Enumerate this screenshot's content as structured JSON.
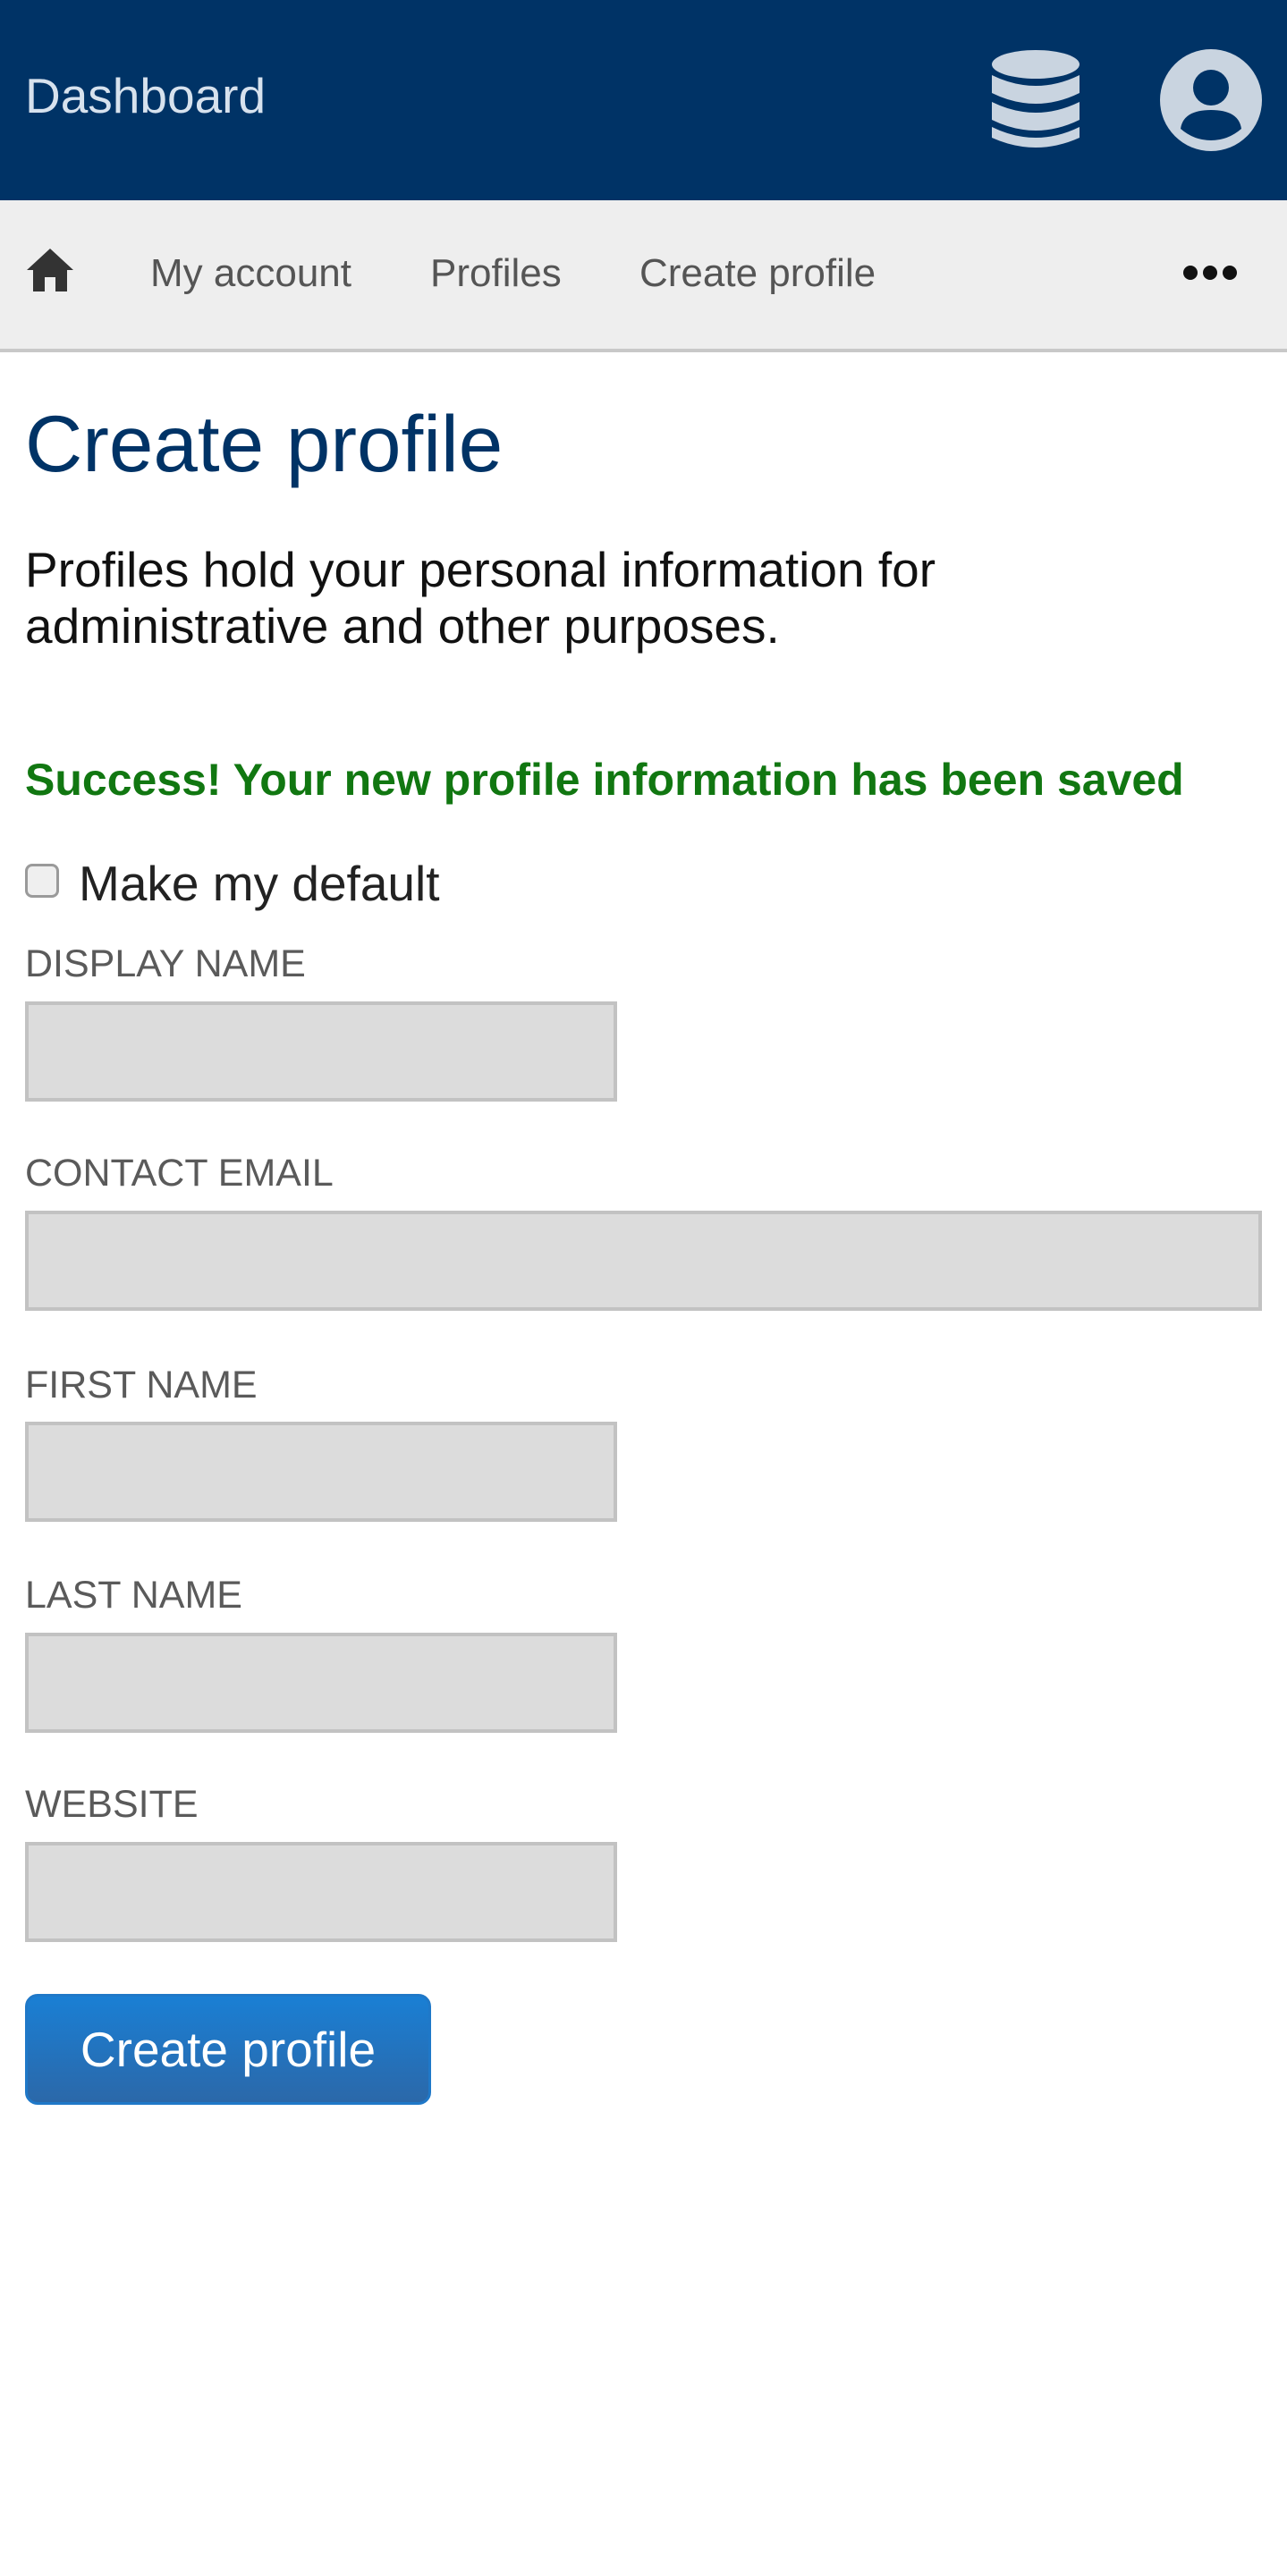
{
  "header": {
    "title": "Dashboard",
    "icons": [
      "database-icon",
      "user-account-icon"
    ],
    "background_color": "#003366"
  },
  "nav": {
    "home_icon": "home-icon",
    "items": [
      {
        "label": "My account"
      },
      {
        "label": "Profiles"
      },
      {
        "label": "Create profile"
      }
    ],
    "more_icon": "more-ellipsis-icon"
  },
  "main": {
    "title": "Create profile",
    "intro": "Profiles hold your personal information for administrative and other purposes.",
    "success_message": "Success! Your new profile information has been saved",
    "success_color": "#117711",
    "default_checkbox": {
      "label": "Make my default",
      "checked": false
    },
    "fields": [
      {
        "label": "DISPLAY NAME",
        "value": ""
      },
      {
        "label": "CONTACT EMAIL",
        "value": ""
      },
      {
        "label": "FIRST NAME",
        "value": ""
      },
      {
        "label": "LAST NAME",
        "value": ""
      },
      {
        "label": "WEBSITE",
        "value": ""
      }
    ],
    "submit_label": "Create profile",
    "accent_color": "#1a7fd4"
  }
}
